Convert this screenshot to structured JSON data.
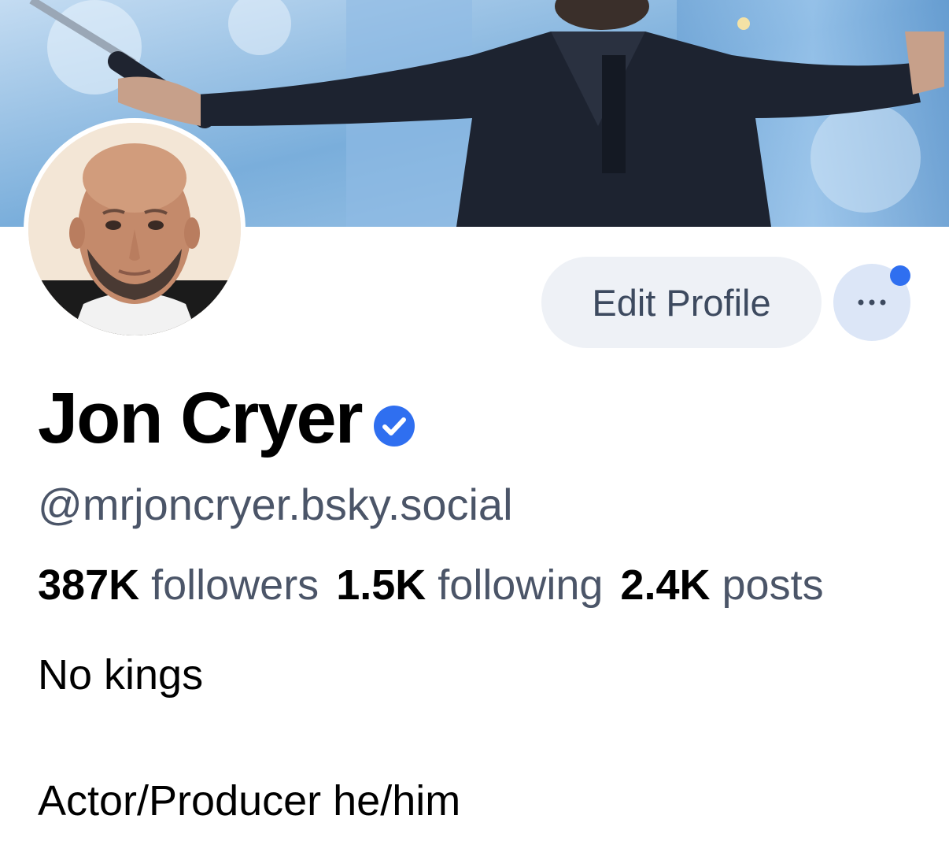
{
  "profile": {
    "display_name": "Jon Cryer",
    "handle": "@mrjoncryer.bsky.social",
    "verified": true,
    "stats": {
      "followers_count": "387K",
      "followers_label": "followers",
      "following_count": "1.5K",
      "following_label": "following",
      "posts_count": "2.4K",
      "posts_label": "posts"
    },
    "bio": {
      "line1": "No kings",
      "line2": "Actor/Producer he/him"
    }
  },
  "actions": {
    "edit_profile_label": "Edit Profile",
    "more_icon": "ellipsis-icon",
    "notification_dot": true
  },
  "colors": {
    "accent": "#2f6ff0",
    "verified_badge": "#2f6ff0",
    "muted_text": "#4b5568",
    "button_bg": "#eef1f6",
    "more_button_bg": "#dce6f7"
  }
}
